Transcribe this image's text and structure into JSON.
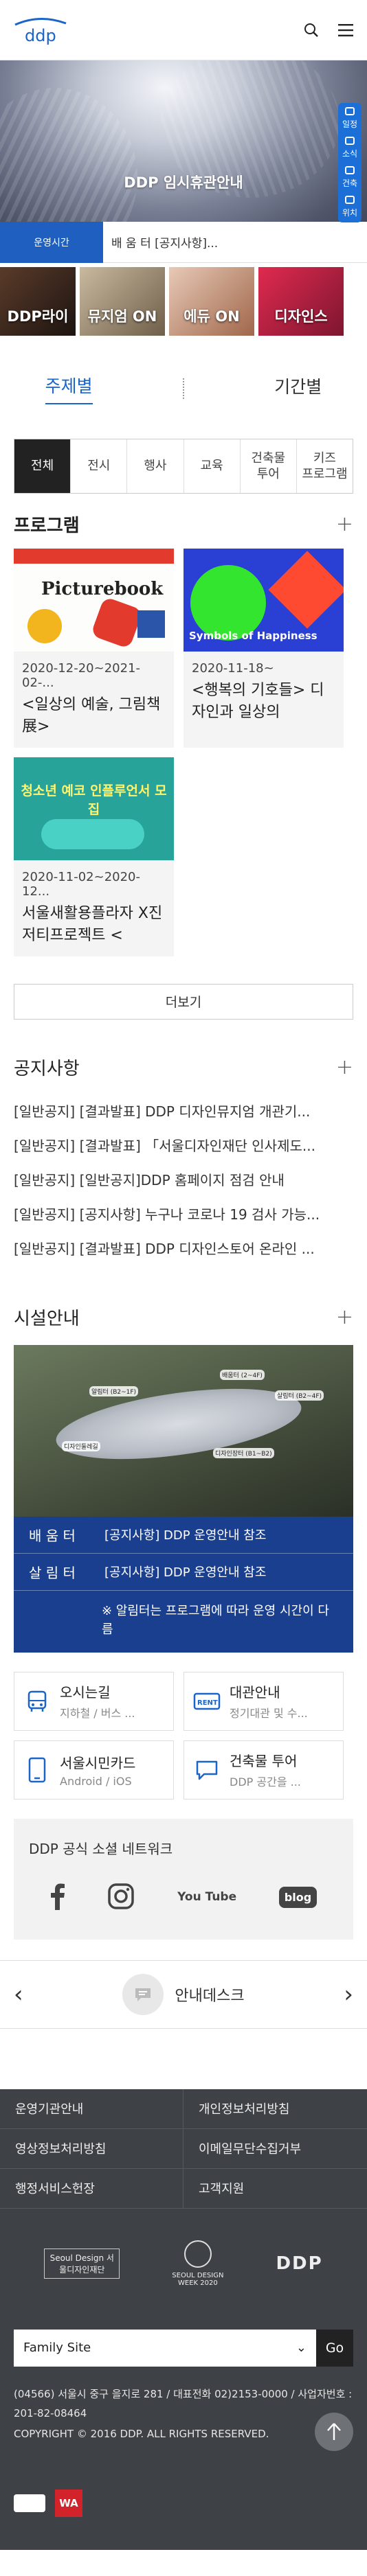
{
  "header": {
    "logo_text": "ddp",
    "search_icon": "search-icon",
    "menu_icon": "hamburger-menu-icon"
  },
  "hero": {
    "title": "DDP 임시휴관안내",
    "side_tabs": [
      {
        "label": "일정",
        "icon": "calendar-icon"
      },
      {
        "label": "소식",
        "icon": "news-icon"
      },
      {
        "label": "건축",
        "icon": "building-icon"
      },
      {
        "label": "위치",
        "icon": "location-icon"
      }
    ]
  },
  "notice_bar": {
    "label": "운영시간",
    "text": "배 움 터 [공지사항]..."
  },
  "quick_links": [
    {
      "label": "DDP라이"
    },
    {
      "label": "뮤지엄 ON"
    },
    {
      "label": "에듀 ON"
    },
    {
      "label": "디자인스"
    }
  ],
  "view_tabs": [
    {
      "label": "주제별",
      "active": true
    },
    {
      "label": "기간별",
      "active": false
    }
  ],
  "category_tabs": [
    {
      "label": "전체",
      "active": true
    },
    {
      "label": "전시"
    },
    {
      "label": "행사"
    },
    {
      "label": "교육"
    },
    {
      "label": "건축물\n투어"
    },
    {
      "label": "키즈\n프로그램"
    }
  ],
  "program": {
    "title": "프로그램",
    "cards": [
      {
        "date": "2020-12-20~2021-02-...",
        "title": "<일상의 예술, 그림책 展>",
        "image_text": "Picturebook"
      },
      {
        "date": "2020-11-18~",
        "title": "<행복의 기호들> 디자인과 일상의",
        "image_text": "Symbols of Happiness"
      },
      {
        "date": "2020-11-02~2020-12...",
        "title": "서울새활용플라자 X진저티프로젝트 <",
        "image_text": "청소년 예코 인플루언서 모집"
      }
    ],
    "more_label": "더보기"
  },
  "notices": {
    "title": "공지사항",
    "items": [
      "[일반공지] [결과발표] DDP 디자인뮤지엄 개관기...",
      "[일반공지] [결과발표] 「서울디자인재단 인사제도...",
      "[일반공지] [일반공지]DDP 홈페이지 점검 안내",
      "[일반공지] [공지사항] 누구나 코로나 19 검사 가능...",
      "[일반공지] [결과발표] DDP 디자인스토어 온라인 ..."
    ]
  },
  "facility": {
    "title": "시설안내",
    "map_labels": [
      "배움터 (2~4F)",
      "알림터 (B2~1F)",
      "살림터 (B2~4F)",
      "디자인둘레길",
      "디자인장터 (B1~B2)"
    ],
    "rows": [
      {
        "name": "배 움 터",
        "text": "[공지사항] DDP 운영안내 참조"
      },
      {
        "name": "살 림 터",
        "text": "[공지사항] DDP 운영안내 참조"
      }
    ],
    "note": "※ 알림터는 프로그램에 따라 운영 시간이 다름"
  },
  "info_boxes": [
    {
      "title": "오시는길",
      "sub": "지하철 / 버스 ...",
      "icon": "bus-icon"
    },
    {
      "title": "대관안내",
      "sub": "정기대관 및 수...",
      "icon": "rent-icon"
    },
    {
      "title": "서울시민카드",
      "sub": "Android / iOS",
      "icon": "mobile-card-icon"
    },
    {
      "title": "건축물 투어",
      "sub": "DDP 공간을 ...",
      "icon": "speech-bubble-icon"
    }
  ],
  "social": {
    "title": "DDP 공식 소셜 네트워크",
    "icons": [
      "facebook-icon",
      "instagram-icon",
      "youtube-icon",
      "blog-icon"
    ],
    "youtube_label": "You Tube",
    "blog_label": "blog"
  },
  "info_desk": {
    "label": "안내데스크"
  },
  "footer": {
    "links": [
      "운영기관안내",
      "개인정보처리방침",
      "영상정보처리방침",
      "이메일무단수집거부",
      "행정서비스헌장",
      "고객지원"
    ],
    "logos": [
      "Seoul Design 서울디자인재단",
      "SEOUL DESIGN WEEK 2020",
      "DDP"
    ],
    "family_site": "Family Site",
    "go_label": "Go",
    "address": "(04566) 서울시 중구 을지로 281 / 대표전화 02)2153-0000 / 사업자번호 : 201-82-08464",
    "copyright": "COPYRIGHT © 2016 DDP. ALL RIGHTS RESERVED.",
    "marks": [
      "WA"
    ]
  },
  "colors": {
    "accent": "#1b64c8",
    "side_tab": "#1c6fd6",
    "facility_bg": "#1a3f8f",
    "footer_bg": "#3e4246"
  }
}
